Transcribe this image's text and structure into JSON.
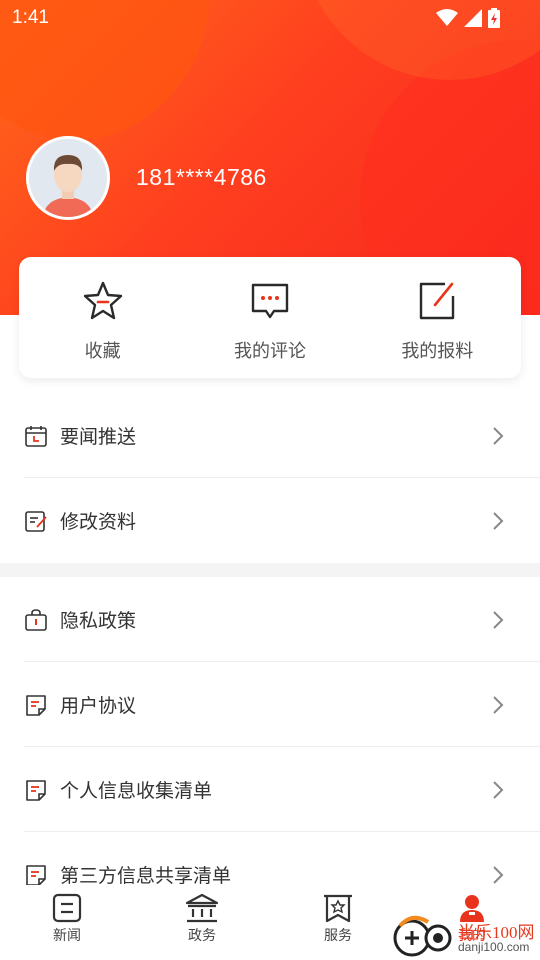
{
  "status_bar": {
    "time": "1:41"
  },
  "profile": {
    "username": "181****4786"
  },
  "quick_actions": [
    {
      "label": "收藏",
      "icon": "star-icon"
    },
    {
      "label": "我的评论",
      "icon": "comment-icon"
    },
    {
      "label": "我的报料",
      "icon": "edit-icon"
    }
  ],
  "menu": {
    "group1": [
      {
        "label": "要闻推送",
        "icon": "calendar-icon"
      },
      {
        "label": "修改资料",
        "icon": "edit-doc-icon"
      }
    ],
    "group2": [
      {
        "label": "隐私政策",
        "icon": "lock-bag-icon"
      },
      {
        "label": "用户协议",
        "icon": "document-icon"
      },
      {
        "label": "个人信息收集清单",
        "icon": "document-icon"
      },
      {
        "label": "第三方信息共享清单",
        "icon": "document-icon"
      }
    ]
  },
  "bottom_nav": [
    {
      "label": "新闻",
      "icon": "news-icon"
    },
    {
      "label": "政务",
      "icon": "government-icon"
    },
    {
      "label": "服务",
      "icon": "service-icon"
    },
    {
      "label": "我的",
      "icon": "profile-icon",
      "active": true
    }
  ],
  "watermark": {
    "main": "当乐100网",
    "sub": "danji100.com"
  },
  "colors": {
    "accent": "#e8341c",
    "header_start": "#ff6a1a",
    "header_end": "#f5261e"
  }
}
